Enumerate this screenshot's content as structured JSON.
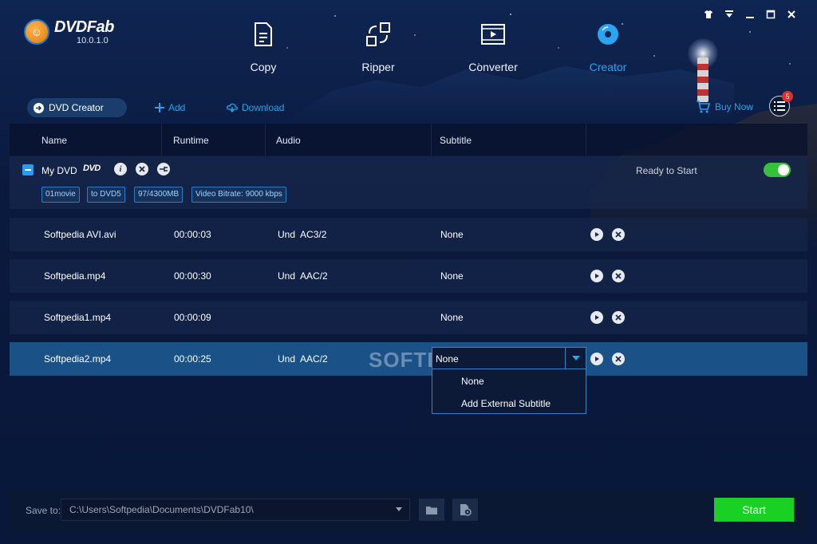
{
  "app": {
    "name": "DVDFab",
    "version": "10.0.1.0"
  },
  "nav": [
    {
      "label": "Copy",
      "icon": "copy-icon"
    },
    {
      "label": "Ripper",
      "icon": "ripper-icon"
    },
    {
      "label": "Converter",
      "icon": "converter-icon"
    },
    {
      "label": "Creator",
      "icon": "creator-icon",
      "active": true
    }
  ],
  "toolbar": {
    "mode": "DVD Creator",
    "add": "Add",
    "download": "Download",
    "buy_now": "Buy Now",
    "queue_count": "5"
  },
  "columns": [
    "Name",
    "Runtime",
    "Audio",
    "Subtitle"
  ],
  "dvd": {
    "name": "My DVD",
    "logo": "DVD",
    "tags": [
      "01movie",
      "to DVD5",
      "97/4300MB",
      "Video Bitrate: 9000 kbps"
    ],
    "status": "Ready to Start",
    "enabled": true
  },
  "files": [
    {
      "name": "Softpedia AVI.avi",
      "runtime": "00:00:03",
      "audio": "Und  AC3/2",
      "subtitle": "None"
    },
    {
      "name": "Softpedia.mp4",
      "runtime": "00:00:30",
      "audio": "Und  AAC/2",
      "subtitle": "None"
    },
    {
      "name": "Softpedia1.mp4",
      "runtime": "00:00:09",
      "audio": "",
      "subtitle": "None"
    },
    {
      "name": "Softpedia2.mp4",
      "runtime": "00:00:25",
      "audio": "Und  AAC/2",
      "subtitle": "None",
      "selected": true
    }
  ],
  "subtitle_dropdown": {
    "value": "None",
    "options": [
      "None",
      "Add External Subtitle"
    ]
  },
  "watermark": "SOFTPEDIA",
  "bottom": {
    "save_to_label": "Save to:",
    "path": "C:\\Users\\Softpedia\\Documents\\DVDFab10\\",
    "start": "Start"
  },
  "colors": {
    "accent": "#2aa3f0",
    "start": "#19d124",
    "toggle_on": "#35c23a",
    "badge": "#d8302a",
    "selected_row": "#1a5288"
  }
}
